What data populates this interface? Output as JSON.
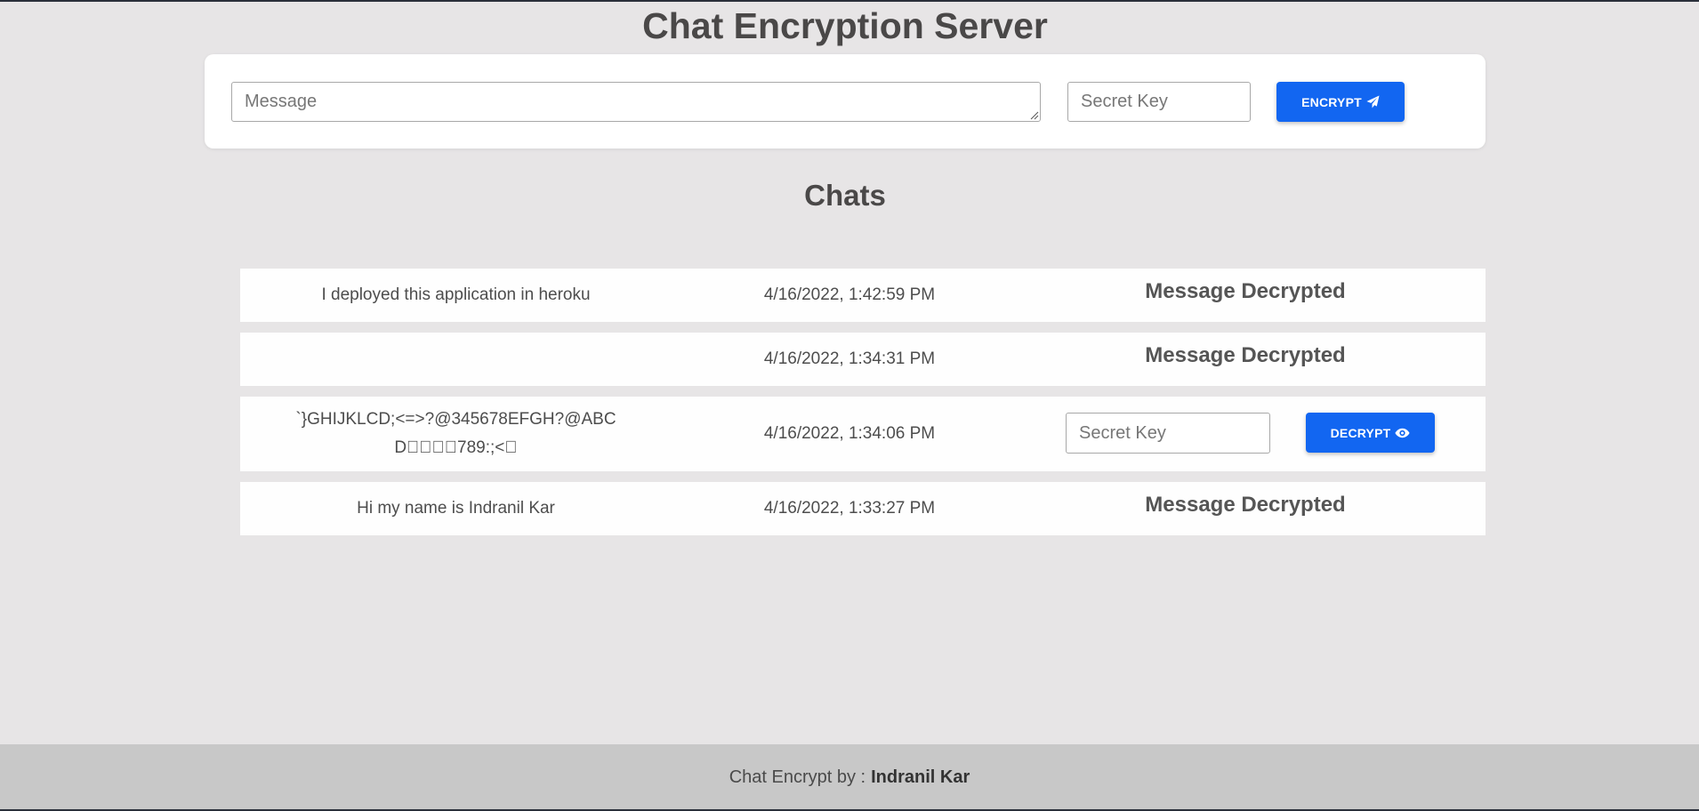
{
  "header": {
    "title": "Chat Encryption Server"
  },
  "compose": {
    "message_placeholder": "Message",
    "key_placeholder": "Secret Key",
    "encrypt_label": "ENCRYPT"
  },
  "chats_title": "Chats",
  "chats": [
    {
      "message": "I deployed this application in heroku",
      "time": "4/16/2022, 1:42:59 PM",
      "status": "Message Decrypted"
    },
    {
      "message": "",
      "time": "4/16/2022, 1:34:31 PM",
      "status": "Message Decrypted"
    },
    {
      "message": "`}GHIJKLCD;<=>?@345678EFGH?@ABCD\u0000\u0000\u0000\u0000789:;<\u0000",
      "time": "4/16/2022, 1:34:06 PM",
      "key_placeholder": "Secret Key",
      "decrypt_label": "DECRYPT"
    },
    {
      "message": "Hi my name is Indranil Kar",
      "time": "4/16/2022, 1:33:27 PM",
      "status": "Message Decrypted"
    }
  ],
  "footer": {
    "prefix": "Chat Encrypt by :",
    "author": "Indranil Kar"
  },
  "icons": {
    "encrypt": "paper-plane-icon",
    "decrypt": "eye-icon"
  },
  "colors": {
    "accent": "#1266f1",
    "background": "#e7e5e6",
    "footer": "#c8c8c8"
  }
}
